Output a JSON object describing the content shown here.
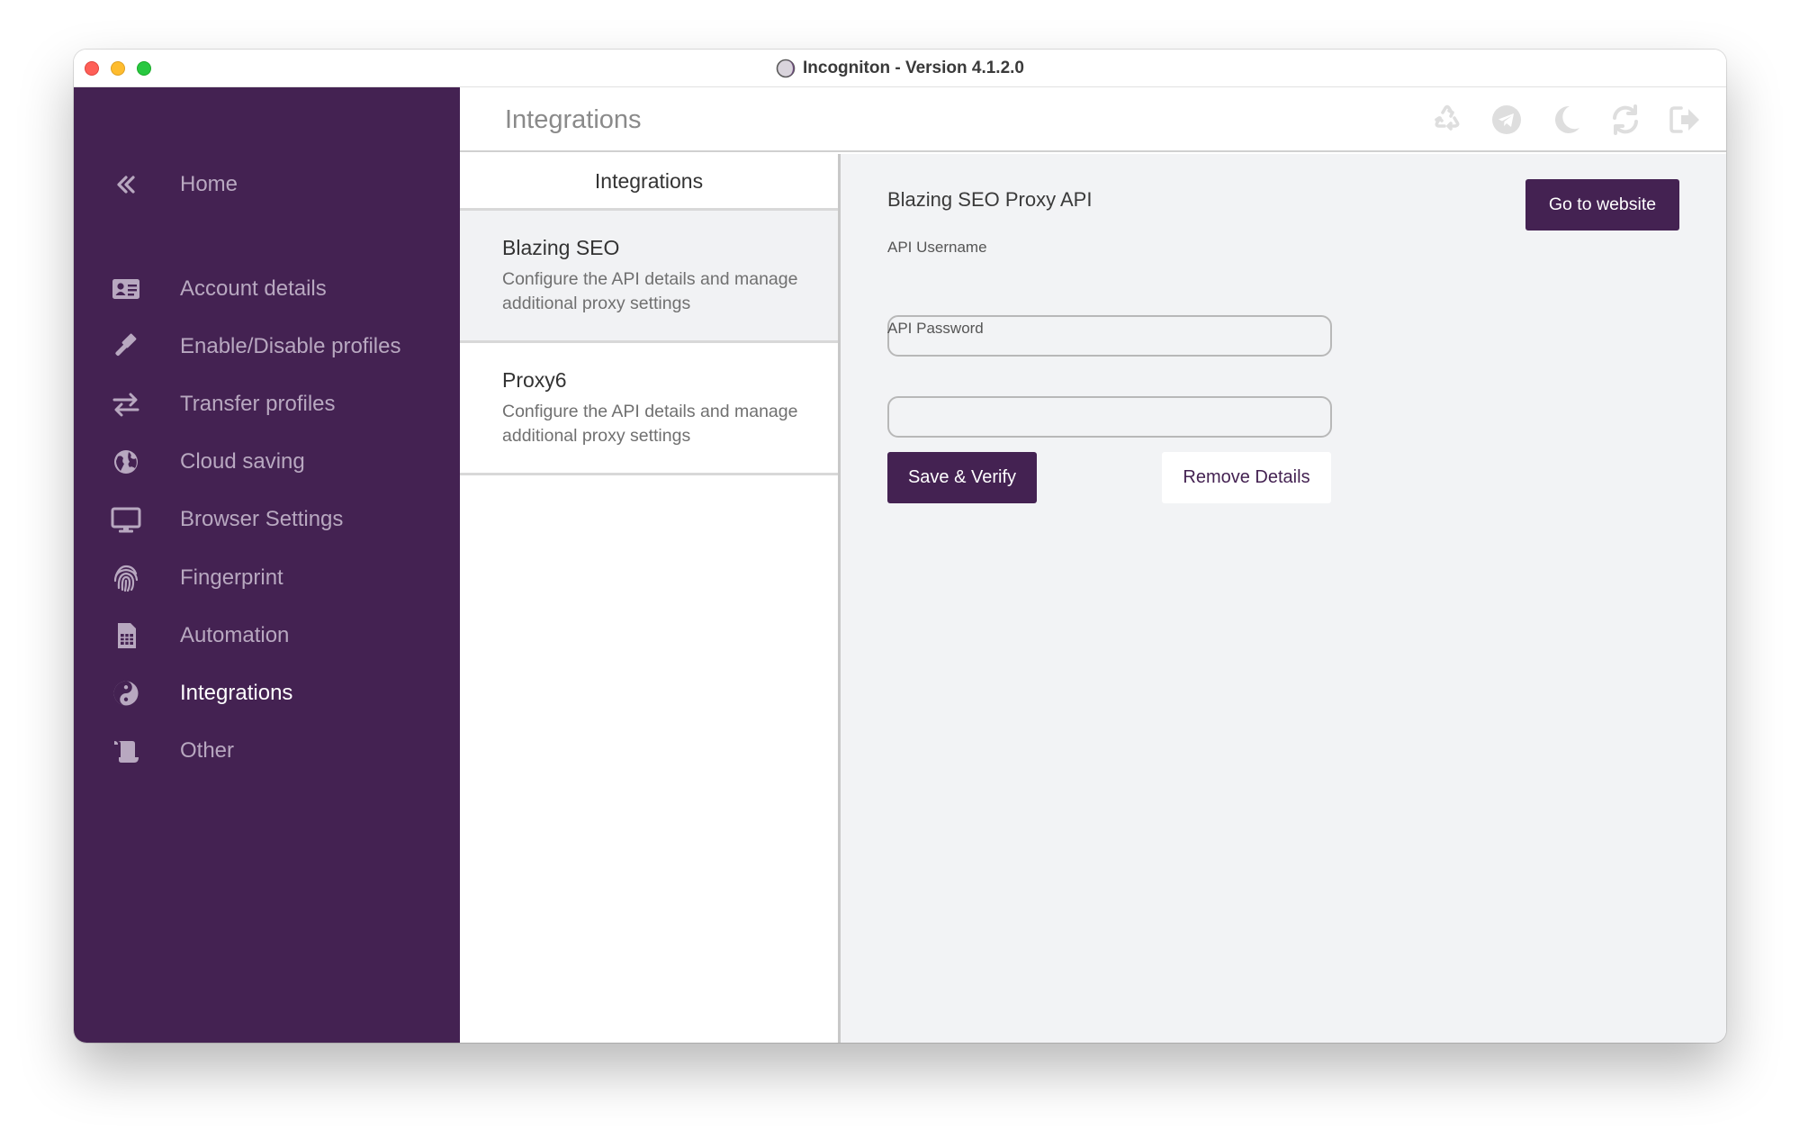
{
  "window": {
    "title": "Incogniton - Version 4.1.2.0"
  },
  "sidebar": {
    "home": {
      "label": "Home",
      "icon": "double-chevron-left-icon"
    },
    "items": [
      {
        "label": "Account details",
        "icon": "id-card-icon",
        "active": false
      },
      {
        "label": "Enable/Disable profiles",
        "icon": "gavel-icon",
        "active": false
      },
      {
        "label": "Transfer profiles",
        "icon": "exchange-arrows-icon",
        "active": false
      },
      {
        "label": "Cloud saving",
        "icon": "globe-icon",
        "active": false
      },
      {
        "label": "Browser Settings",
        "icon": "monitor-icon",
        "active": false
      },
      {
        "label": "Fingerprint",
        "icon": "fingerprint-icon",
        "active": false
      },
      {
        "label": "Automation",
        "icon": "sim-card-icon",
        "active": false
      },
      {
        "label": "Integrations",
        "icon": "yin-yang-icon",
        "active": true
      },
      {
        "label": "Other",
        "icon": "scroll-icon",
        "active": false
      }
    ]
  },
  "header": {
    "title": "Integrations",
    "icons": [
      "recycle-icon",
      "telegram-icon",
      "moon-icon",
      "refresh-icon",
      "sign-out-icon"
    ]
  },
  "integrations": {
    "header": "Integrations",
    "items": [
      {
        "title": "Blazing SEO",
        "description": "Configure the API details and manage additional proxy settings",
        "selected": true
      },
      {
        "title": "Proxy6",
        "description": "Configure the API details and manage additional proxy settings",
        "selected": false
      }
    ]
  },
  "detail": {
    "title": "Blazing SEO Proxy API",
    "go_to_website": "Go to website",
    "username_label": "API Username",
    "username_value": "",
    "password_label": "API Password",
    "password_value": "",
    "save_label": "Save & Verify",
    "remove_label": "Remove Details"
  },
  "colors": {
    "sidebar_bg": "#442252",
    "accent": "#442252",
    "detail_bg": "#f2f3f5"
  }
}
